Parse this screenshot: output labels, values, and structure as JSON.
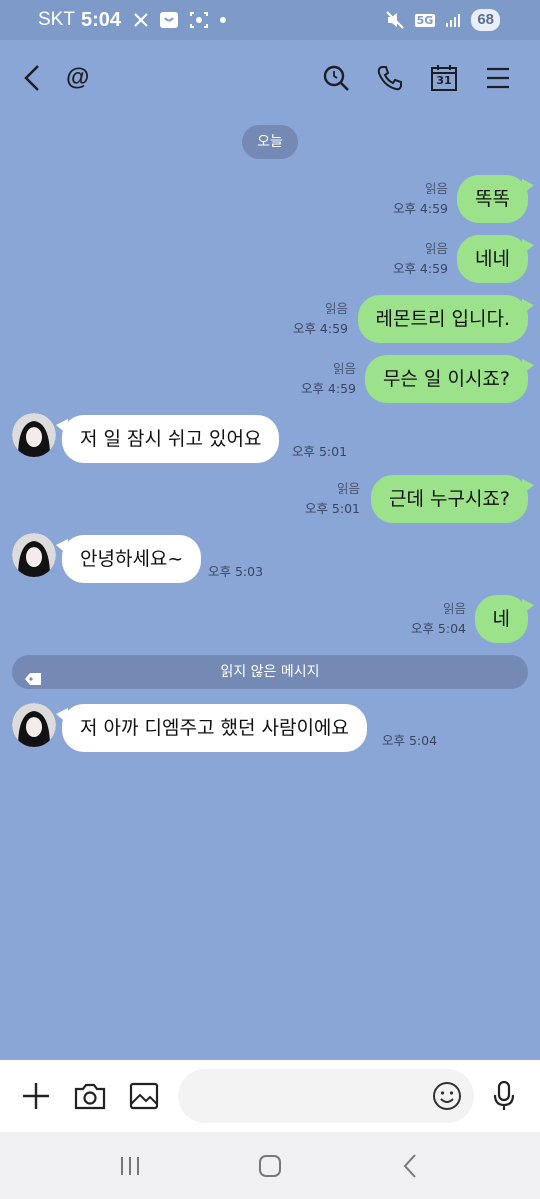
{
  "status_bar": {
    "carrier": "SKT",
    "time": "5:04",
    "network": "5G",
    "battery": "68"
  },
  "header": {
    "title": "@"
  },
  "chat": {
    "date_chip": "오늘",
    "read_label": "읽음",
    "messages": [
      {
        "dir": "out",
        "text": "똑똑",
        "time": "오후 4:59",
        "read": "읽음"
      },
      {
        "dir": "out",
        "text": "네네",
        "time": "오후 4:59",
        "read": "읽음"
      },
      {
        "dir": "out",
        "text": "레몬트리 입니다.",
        "time": "오후 4:59",
        "read": "읽음"
      },
      {
        "dir": "out",
        "text": "무슨 일 이시죠?",
        "time": "오후 4:59",
        "read": "읽음"
      },
      {
        "dir": "in",
        "text": "저 일 잠시 쉬고 있어요",
        "time": "오후 5:01"
      },
      {
        "dir": "out",
        "text": "근데 누구시죠?",
        "time": "오후 5:01",
        "read": "읽음"
      },
      {
        "dir": "in",
        "text": "안녕하세요~",
        "time": "오후 5:03"
      },
      {
        "dir": "out",
        "text": "네",
        "time": "오후 5:04",
        "read": "읽음"
      },
      {
        "dir": "in",
        "text": "저 아까 디엠주고 했던 사람이에요",
        "time": "오후 5:04"
      }
    ],
    "unread_divider": "읽지 않은 메시지"
  },
  "input": {
    "value": "",
    "placeholder": ""
  },
  "colors": {
    "background": "#8aa6d6",
    "outgoing_bubble": "#9be28a",
    "incoming_bubble": "#ffffff",
    "chip": "#7489b3"
  },
  "icons": [
    "back-icon",
    "search-icon",
    "phone-icon",
    "calendar-icon",
    "menu-icon",
    "plus-icon",
    "camera-icon",
    "gallery-icon",
    "emoji-icon",
    "mic-icon"
  ],
  "calendar_day": "31"
}
